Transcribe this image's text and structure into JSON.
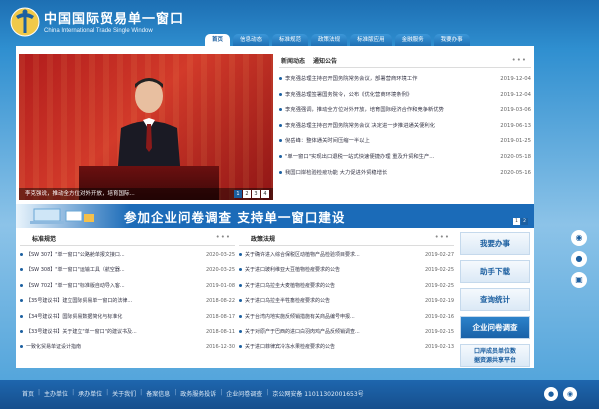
{
  "site": {
    "title": "中国国际贸易单一窗口",
    "subtitle": "China International Trade Single Window"
  },
  "nav": {
    "tabs": [
      "首页",
      "信息动态",
      "标准规范",
      "政策法规",
      "标准版应用",
      "金融服务",
      "我要办事"
    ],
    "active_index": 0
  },
  "hero": {
    "caption": "李克强说，推动全方位对外开放，培育国际... ",
    "pages": [
      "1",
      "2",
      "3",
      "4"
    ],
    "active_page": 0
  },
  "news": {
    "tab_active": "新闻动态",
    "tab_other": "通知公告",
    "more": "•••",
    "items": [
      {
        "title": "李克强总理主持召开国务院常务会议，部署营商环境工作",
        "date": "2019-12-04"
      },
      {
        "title": "李克强总理签署国务院令，公布《优化营商环境条例》",
        "date": "2019-12-04"
      },
      {
        "title": "李克强强调，推动全方位对外开放，培育国际经济合作和竞争新优势",
        "date": "2019-03-06"
      },
      {
        "title": "李克强总理主持召开国务院常务会议 决定进一步推进通关便利化",
        "date": "2019-06-13"
      },
      {
        "title": "倪岳峰：整体通关时间压缩一半以上",
        "date": "2019-01-25"
      },
      {
        "title": "\"单一窗口\"实现出口退税一站式快速便捷办理 重及升贸和生产...",
        "date": "2020-05-18"
      },
      {
        "title": "我国口岸检验检疫功能 大力促进外贸稳增长",
        "date": "2020-05-16"
      }
    ]
  },
  "banner": {
    "text": "参加企业问卷调查  支持单一窗口建设",
    "pages": [
      "1",
      "2"
    ],
    "active_page": 1
  },
  "standards": {
    "title": "标准规范",
    "more": "•••",
    "items": [
      {
        "title": "【SW 307】\"单一窗口\"公路舱单报文接口...",
        "date": "2020-03-25"
      },
      {
        "title": "【SW 308】\"单一窗口\"运输工具（航空器...",
        "date": "2020-03-25"
      },
      {
        "title": "【SW 702】\"单一窗口\"标准版自动导入客...",
        "date": "2019-01-08"
      },
      {
        "title": "【35号建议书】建立国际贸易单一窗口的法律...",
        "date": "2018-08-22"
      },
      {
        "title": "【34号建议书】国际贸易数据简化与标准化",
        "date": "2018-08-17"
      },
      {
        "title": "【33号建议书】关于建立\"单一窗口\"的建议书及...",
        "date": "2018-08-11"
      },
      {
        "title": "一致化贸易单证设计指南",
        "date": "2016-12-30"
      }
    ]
  },
  "policies": {
    "title": "政策法规",
    "more": "•••",
    "items": [
      {
        "title": "关于确许进入综合保税区动植物产品检验项目要求...",
        "date": "2019-02-27"
      },
      {
        "title": "关于进口玻利维亚大豆植物检疫要求的公告",
        "date": "2019-02-25"
      },
      {
        "title": "关于进口乌拉圭大麦植物检疫要求的公告",
        "date": "2019-02-25"
      },
      {
        "title": "关于进口乌拉圭半牲畜检疫要求的公告",
        "date": "2019-02-19"
      },
      {
        "title": "关于台湾内地实施反倾销措施有关商品编号申报...",
        "date": "2019-02-16"
      },
      {
        "title": "关于对原产于巴西的进口白羽肉鸡产品反倾销调查...",
        "date": "2019-02-15"
      },
      {
        "title": "关于进口菲律宾冷冻水果检疫要求的公告",
        "date": "2019-02-13"
      }
    ]
  },
  "side": {
    "buttons": [
      "我要办事",
      "助手下载",
      "查询统计",
      "企业问卷调查"
    ],
    "last_line1": "口岸成员单位数",
    "last_line2": "据资源共享平台"
  },
  "footer": {
    "links": [
      "首页",
      "主办单位",
      "承办单位",
      "关于我们",
      "备案信息",
      "政务服务投诉",
      "企业问卷调查",
      "京公网安备 11011302001653号"
    ]
  },
  "colors": {
    "brand": "#1c5fa0",
    "accent": "#1b6bb8",
    "hero": "#b11c1c"
  }
}
